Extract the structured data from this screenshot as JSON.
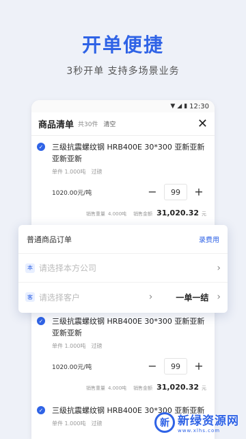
{
  "hero": {
    "title": "开单便捷",
    "subtitle": "3秒开单 支持多场景业务"
  },
  "statusbar": {
    "time": "12:30"
  },
  "sheet": {
    "title": "商品清单",
    "count": "共30件",
    "clear": "清空",
    "close": "✕"
  },
  "items": [
    {
      "name": "三级抗震螺纹钢 HRB400E 30*300 亚新亚新亚新亚新",
      "unit_weight": "单件 1.000吨",
      "weigh": "过磅",
      "price": "1020.00元/吨",
      "qty": "99",
      "weight_label": "销售重量",
      "weight": "4.000吨",
      "amount_label": "销售金额",
      "amount": "31,020.32",
      "amount_unit": "元"
    },
    {
      "name": "三级抗震螺纹钢 HRB400E 30*300 亚新亚新亚新亚新",
      "unit_weight": "单件 1.000吨",
      "weigh": "过磅",
      "price": "1020.00元/吨",
      "qty": "99",
      "weight_label": "销售重量",
      "weight": "4.000吨",
      "amount_label": "销售金额",
      "amount": "31,020.32",
      "amount_unit": "元"
    },
    {
      "name": "三级抗震螺纹钢 HRB400E 30*300 亚新亚新",
      "unit_weight": "单件 1.000吨",
      "weigh": "过磅"
    }
  ],
  "popup": {
    "title": "普通商品订单",
    "link": "录费用",
    "company_tag": "本",
    "company_placeholder": "请选择本方公司",
    "customer_tag": "客",
    "customer_placeholder": "请选择客户",
    "settle": "一单一结"
  },
  "watermark": {
    "logo": "新",
    "name": "新绿资源网",
    "url": "www.xlhs.com"
  },
  "colors": {
    "accent": "#2f63e6",
    "background": "#eef1f8"
  }
}
